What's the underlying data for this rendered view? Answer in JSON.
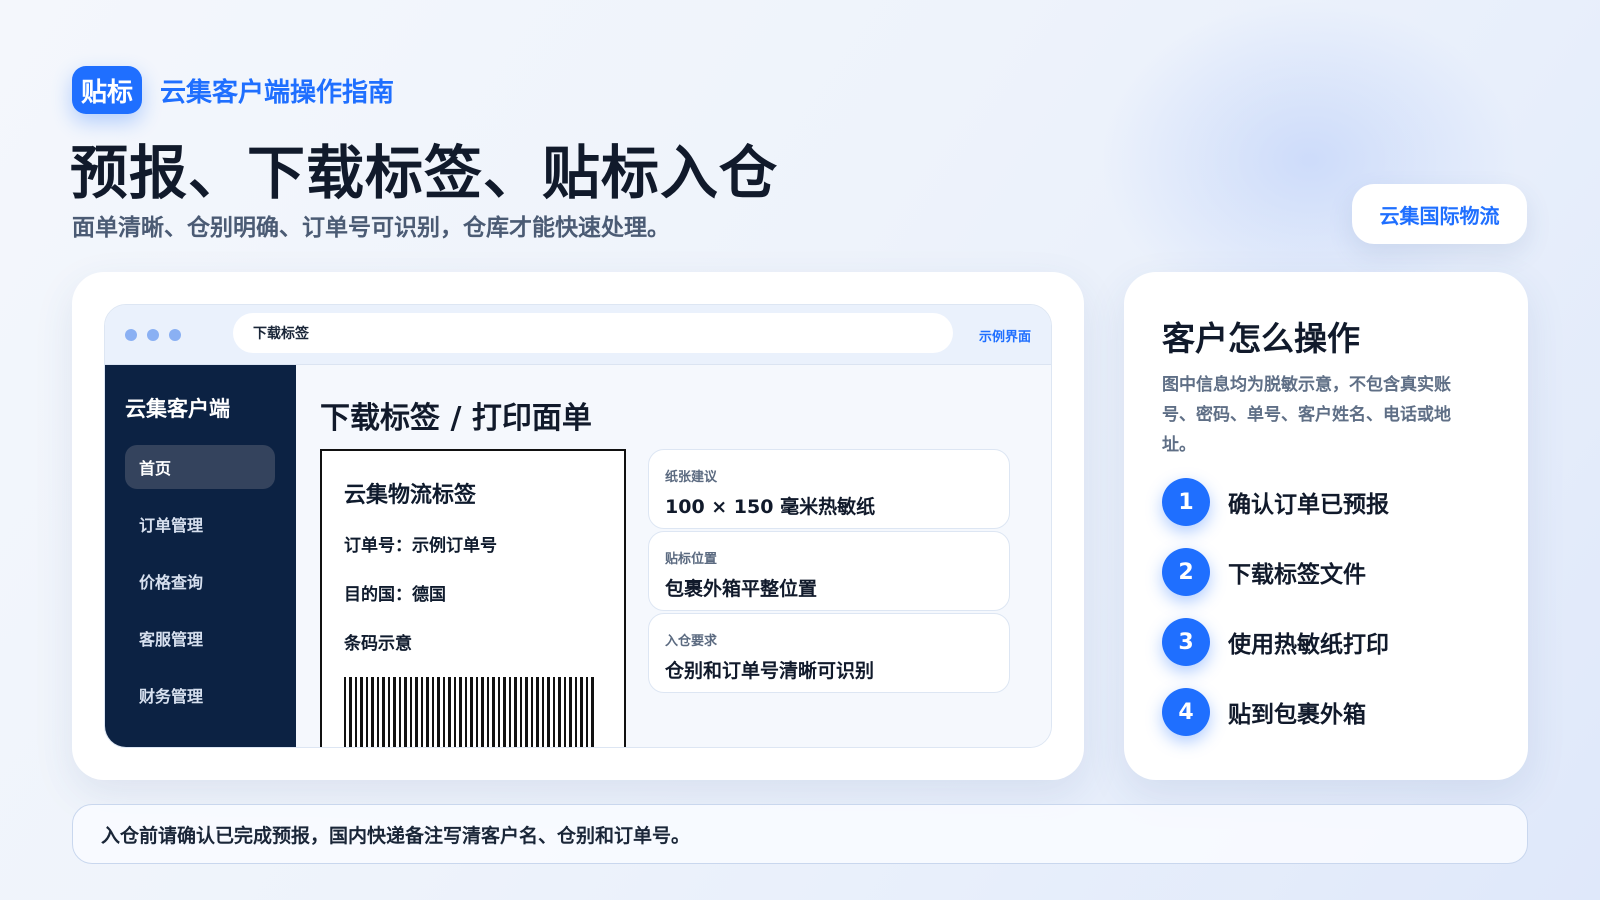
{
  "header": {
    "badge": "贴标",
    "guide_title": "云集客户端操作指南",
    "main_title": "预报、下载标签、贴标入仓",
    "subtitle": "面单清晰、仓别明确、订单号可识别，仓库才能快速处理。",
    "brand": "云集国际物流"
  },
  "browser": {
    "address": "下载标签",
    "tag": "示例界面"
  },
  "sidebar": {
    "app_name": "云集客户端",
    "items": [
      {
        "label": "首页",
        "active": true
      },
      {
        "label": "订单管理",
        "active": false
      },
      {
        "label": "价格查询",
        "active": false
      },
      {
        "label": "客服管理",
        "active": false
      },
      {
        "label": "财务管理",
        "active": false
      }
    ]
  },
  "content": {
    "heading": "下载标签 / 打印面单",
    "label": {
      "title": "云集物流标签",
      "order": "订单号：示例订单号",
      "country": "目的国：德国",
      "barcode": "条码示意"
    },
    "info_cards": [
      {
        "key": "纸张建议",
        "value": "100 × 150 毫米热敏纸"
      },
      {
        "key": "贴标位置",
        "value": "包裹外箱平整位置"
      },
      {
        "key": "入仓要求",
        "value": "仓别和订单号清晰可识别"
      }
    ]
  },
  "right_panel": {
    "title": "客户怎么操作",
    "note": "图中信息均为脱敏示意，不包含真实账号、密码、单号、客户姓名、电话或地址。",
    "steps": [
      {
        "num": "1",
        "text": "确认订单已预报"
      },
      {
        "num": "2",
        "text": "下载标签文件"
      },
      {
        "num": "3",
        "text": "使用热敏纸打印"
      },
      {
        "num": "4",
        "text": "贴到包裹外箱"
      }
    ]
  },
  "footer": {
    "text": "入仓前请确认已完成预报，国内快递备注写清客户名、仓别和订单号。"
  },
  "colors": {
    "accent": "#1f6fff",
    "sidebar": "#0c2243",
    "sidebar_active": "#34435d"
  }
}
